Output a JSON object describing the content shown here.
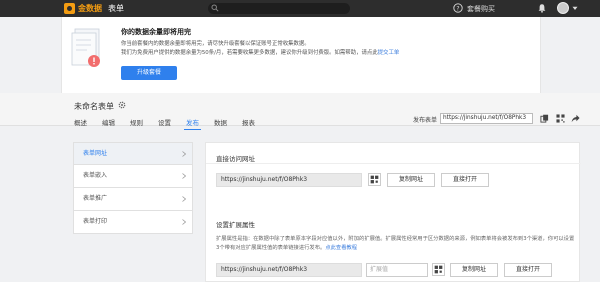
{
  "topbar": {
    "logo_text": "金数据",
    "nav_forms": "表单",
    "help": "套餐购买",
    "accent": "#f39c12"
  },
  "notice": {
    "title": "你的数据余量即将用完",
    "line1": "你当前套餐内的数据余量即将用完，请尽快升级套餐以保证账号正常收集数据。",
    "line2_prefix": "我们为免费用户提供的数据余量为50条/月，若需要收集更多数据，建议你升级到付费版。如需帮助，请点此",
    "line2_link": "提交工单",
    "upgrade_button": "升级套餐"
  },
  "form": {
    "title": "未命名表单",
    "tabs": [
      "概述",
      "编辑",
      "规则",
      "设置",
      "发布",
      "数据",
      "报表"
    ],
    "active_tab": "发布",
    "publish_label": "发布表单",
    "publish_url": "https://jinshuju.net/f/O8Phk3"
  },
  "sidemenu": {
    "items": [
      "表单网址",
      "表单嵌入",
      "表单推广",
      "表单打印"
    ]
  },
  "content": {
    "direct_title": "直接访问网址",
    "direct_url": "https://jinshuju.net/f/O8Phk3",
    "copy_button": "复制网址",
    "open_button": "直接打开",
    "ext_title": "设置扩展属性",
    "ext_desc": "扩展属性是指：在数据中除了表单原本字段对应值以外，附加的扩展值。扩展属性经常用于区分数据的来源，例如表单将会被发布到3个渠道，你可以设置3个带有对应扩展属性值的表单链接进行发布。",
    "ext_link": "点此查看教程",
    "ext_url": "https://jinshuju.net/f/O8Phk3",
    "param_placeholder": "扩展值",
    "copy_button2": "复制网址",
    "open_button2": "直接打开"
  },
  "colors": {
    "primary": "#2f80ed",
    "topbar_bg": "#2d2d2d"
  }
}
